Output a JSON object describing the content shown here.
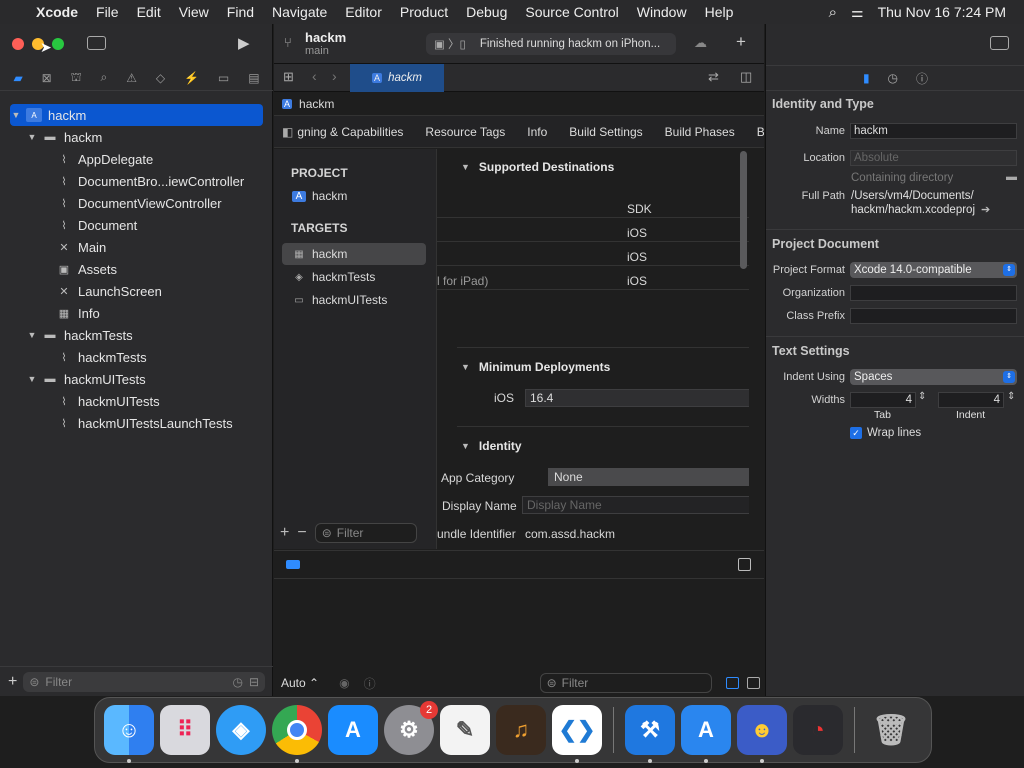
{
  "menubar": {
    "app": "Xcode",
    "items": [
      "File",
      "Edit",
      "View",
      "Find",
      "Navigate",
      "Editor",
      "Product",
      "Debug",
      "Source Control",
      "Window",
      "Help"
    ],
    "clock": "Thu Nov 16  7:24 PM"
  },
  "toolbar": {
    "project": "hackm",
    "branch": "main",
    "scheme": "Finished running hackm on iPhon..."
  },
  "tabbar": {
    "tab": "hackm"
  },
  "navigator": {
    "tree": [
      {
        "label": "hackm",
        "level": 0,
        "kind": "project",
        "open": true,
        "selected": true
      },
      {
        "label": "hackm",
        "level": 1,
        "kind": "folder",
        "open": true
      },
      {
        "label": "AppDelegate",
        "level": 2,
        "kind": "swift"
      },
      {
        "label": "DocumentBro...iewController",
        "level": 2,
        "kind": "swift"
      },
      {
        "label": "DocumentViewController",
        "level": 2,
        "kind": "swift"
      },
      {
        "label": "Document",
        "level": 2,
        "kind": "swift"
      },
      {
        "label": "Main",
        "level": 2,
        "kind": "storyboard"
      },
      {
        "label": "Assets",
        "level": 2,
        "kind": "assets"
      },
      {
        "label": "LaunchScreen",
        "level": 2,
        "kind": "storyboard"
      },
      {
        "label": "Info",
        "level": 2,
        "kind": "plist"
      },
      {
        "label": "hackmTests",
        "level": 1,
        "kind": "folder",
        "open": true
      },
      {
        "label": "hackmTests",
        "level": 2,
        "kind": "swift"
      },
      {
        "label": "hackmUITests",
        "level": 1,
        "kind": "folder",
        "open": true
      },
      {
        "label": "hackmUITests",
        "level": 2,
        "kind": "swift"
      },
      {
        "label": "hackmUITestsLaunchTests",
        "level": 2,
        "kind": "swift"
      }
    ],
    "filter_placeholder": "Filter"
  },
  "jumpbar": {
    "crumb": "hackm"
  },
  "settings_tabs": [
    "gning & Capabilities",
    "Resource Tags",
    "Info",
    "Build Settings",
    "Build Phases",
    "Bu"
  ],
  "project_list": {
    "project_header": "PROJECT",
    "project": "hackm",
    "targets_header": "TARGETS",
    "targets": [
      "hackm",
      "hackmTests",
      "hackmUITests"
    ],
    "filter_placeholder": "Filter"
  },
  "settings": {
    "destinations_title": "Supported Destinations",
    "sdk_header": "SDK",
    "destinations": [
      {
        "name": "",
        "sdk": "iOS"
      },
      {
        "name": "",
        "sdk": "iOS"
      },
      {
        "name": "l for iPad)",
        "sdk": "iOS"
      }
    ],
    "min_deploy_title": "Minimum Deployments",
    "min_deploy_label": "iOS",
    "min_deploy_value": "16.4",
    "identity_title": "Identity",
    "app_category_label": "App Category",
    "app_category_value": "None",
    "display_name_label": "Display Name",
    "display_name_placeholder": "Display Name",
    "bundle_id_label": "undle Identifier",
    "bundle_id_value": "com.assd.hackm"
  },
  "debug": {
    "auto_label": "Auto",
    "filter_placeholder": "Filter"
  },
  "inspector": {
    "identity_title": "Identity and Type",
    "name_label": "Name",
    "name_value": "hackm",
    "location_label": "Location",
    "location_value": "Absolute",
    "containing": "Containing directory",
    "fullpath_label": "Full Path",
    "fullpath_line1": "/Users/vm4/Documents/",
    "fullpath_line2": "hackm/hackm.xcodeproj",
    "projdoc_title": "Project Document",
    "format_label": "Project Format",
    "format_value": "Xcode 14.0-compatible",
    "org_label": "Organization",
    "prefix_label": "Class Prefix",
    "text_title": "Text Settings",
    "indent_label": "Indent Using",
    "indent_value": "Spaces",
    "widths_label": "Widths",
    "tab_value": "4",
    "indent_width_value": "4",
    "tab_caption": "Tab",
    "indent_caption": "Indent",
    "wrap_label": "Wrap lines"
  },
  "dock": {
    "apps": [
      "finder",
      "launchpad",
      "safari",
      "chrome",
      "app-store",
      "system-settings",
      "textedit",
      "garageband",
      "vscode"
    ],
    "badge": "2",
    "right_apps": [
      "xcode",
      "xcode-beta",
      "game",
      "instruments"
    ]
  },
  "colors": {
    "accent": "#0b57d0",
    "close": "#ff5f57",
    "min": "#febc2e",
    "max": "#28c840"
  }
}
